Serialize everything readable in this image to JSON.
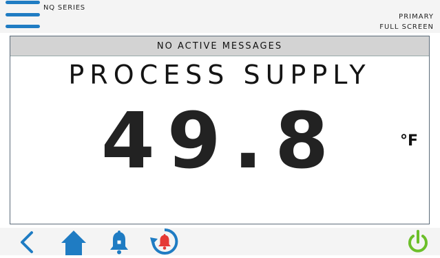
{
  "header": {
    "series": "NQ SERIES",
    "mode_primary": "PRIMARY",
    "mode_screen": "FULL SCREEN"
  },
  "main": {
    "message": "NO ACTIVE MESSAGES",
    "title": "PROCESS SUPPLY",
    "value": "49.8",
    "unit": "°F"
  },
  "footer": {
    "icons": [
      "back-icon",
      "home-icon",
      "alarm-bell-icon",
      "alarm-history-icon",
      "power-icon"
    ]
  },
  "colors": {
    "accent_blue": "#1f7cc3",
    "alarm_red": "#e53935",
    "power_green": "#6cbf2a"
  }
}
